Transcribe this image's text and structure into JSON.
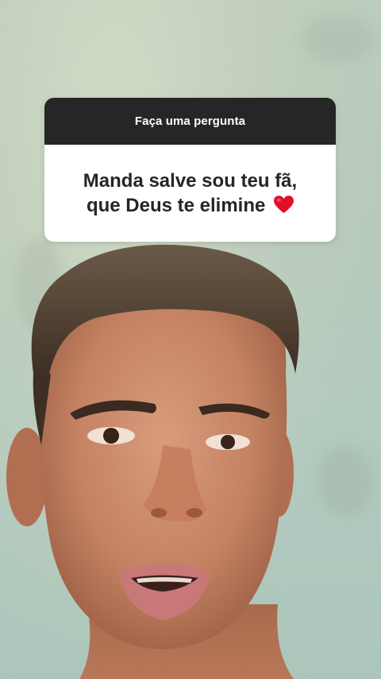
{
  "story": {
    "background_description_colors": {
      "wall": "#bfcdbf",
      "skin": "#c98a6a",
      "hair": "#4a3a2c"
    }
  },
  "question_sticker": {
    "header_label": "Faça uma pergunta",
    "question_line_1": "Manda salve sou teu fã,",
    "question_line_2": "que Deus te elimine",
    "emoji_icon": "red-heart-icon",
    "header_color": "#262626",
    "body_color": "#ffffff",
    "heart_color": "#e0102a"
  }
}
